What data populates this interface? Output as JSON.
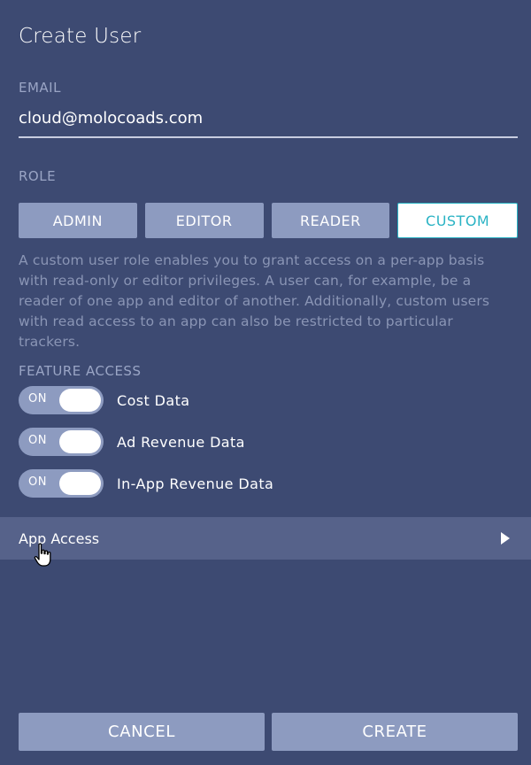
{
  "title": "Create User",
  "email": {
    "label": "EMAIL",
    "value": "cloud@molocoads.com"
  },
  "role": {
    "label": "ROLE",
    "options": [
      "ADMIN",
      "EDITOR",
      "READER",
      "CUSTOM"
    ],
    "selected": "CUSTOM",
    "description": "A custom user role enables you to grant access on a per-app basis with read-only or editor privileges. A user can, for example, be a reader of one app and editor of another. Additionally, custom users with read access to an app can also be restricted to particular trackers."
  },
  "feature_access": {
    "label": "FEATURE ACCESS",
    "toggles": [
      {
        "state": "ON",
        "label": "Cost Data"
      },
      {
        "state": "ON",
        "label": "Ad Revenue Data"
      },
      {
        "state": "ON",
        "label": "In-App Revenue Data"
      }
    ]
  },
  "app_access": {
    "label": "App Access",
    "icon": "chevron-right-icon"
  },
  "footer": {
    "cancel": "CANCEL",
    "create": "CREATE"
  },
  "colors": {
    "background": "#3d4a72",
    "button": "#8d9bc0",
    "accent": "#2ab3c4",
    "row_highlight": "#56628a",
    "muted_text": "#8a95b5"
  }
}
